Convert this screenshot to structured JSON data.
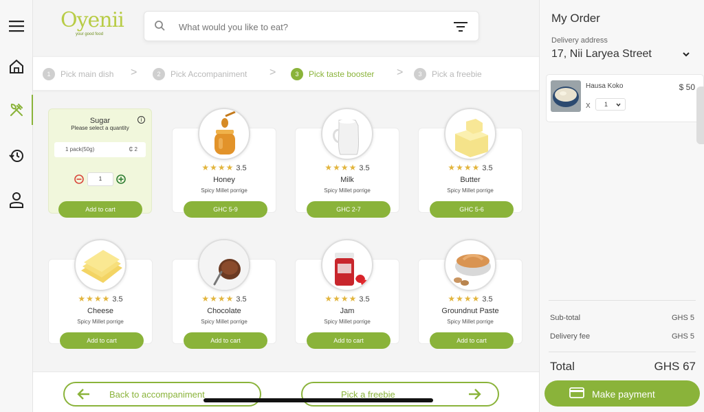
{
  "brand": {
    "logo_text": "Oyenii",
    "tagline": "your good food",
    "accent": "#8ab33a",
    "logo_color": "#b8cc46"
  },
  "nav": {
    "items": [
      "menu-icon",
      "home-icon",
      "cutlery-icon",
      "history-icon",
      "user-icon"
    ],
    "active": "cutlery-icon"
  },
  "search": {
    "placeholder": "What would you like to eat?",
    "value": ""
  },
  "steps": [
    {
      "num": "1",
      "label": "Pick main dish",
      "state": "done"
    },
    {
      "num": "2",
      "label": "Pick Accompaniment",
      "state": "done"
    },
    {
      "num": "3",
      "label": "Pick taste booster",
      "state": "active"
    },
    {
      "num": "3",
      "label": "Pick a freebie",
      "state": "todo"
    }
  ],
  "step_separator": ">",
  "selected_item": {
    "name": "Sugar",
    "subtitle": "Please select a quantity",
    "info": "i",
    "option_label": "1 pack(50g)",
    "option_price": "₵ 2",
    "quantity": "1",
    "button": "Add to cart"
  },
  "products": [
    {
      "name": "Honey",
      "desc": "Spicy Millet porrige",
      "rating": "3.5",
      "stars": "★★★★",
      "button": "GHC 5-9",
      "image": "honey-jar"
    },
    {
      "name": "Milk",
      "desc": "Spicy Millet porrige",
      "rating": "3.5",
      "stars": "★★★★",
      "button": "GHC 2-7",
      "image": "milk-jug"
    },
    {
      "name": "Butter",
      "desc": "Spicy Millet porrige",
      "rating": "3.5",
      "stars": "★★★★",
      "button": "GHC 5-6",
      "image": "butter-block"
    },
    {
      "name": "Cheese",
      "desc": "Spicy Millet porrige",
      "rating": "3.5",
      "stars": "★★★★",
      "button": "Add to cart",
      "image": "cheese-slices"
    },
    {
      "name": "Chocolate",
      "desc": "Spicy Millet porrige",
      "rating": "3.5",
      "stars": "★★★★",
      "button": "Add to cart",
      "image": "chocolate-cup"
    },
    {
      "name": "Jam",
      "desc": "Spicy Millet porrige",
      "rating": "3.5",
      "stars": "★★★★",
      "button": "Add to cart",
      "image": "jam-jar"
    },
    {
      "name": "Groundnut Paste",
      "desc": "Spicy Millet porrige",
      "rating": "3.5",
      "stars": "★★★★",
      "button": "Add to cart",
      "image": "groundnut-bowl"
    }
  ],
  "footer": {
    "back_label": "Back to accompaniment",
    "next_label": "Pick a freebie"
  },
  "order": {
    "title": "My Order",
    "delivery_label": "Delivery address",
    "delivery_address": "17, Nii Laryea Street",
    "items": [
      {
        "name": "Hausa Koko",
        "price": "$ 50",
        "qty_prefix": "X",
        "qty": "1",
        "image": "porridge-bowl"
      }
    ],
    "subtotal_label": "Sub-total",
    "subtotal_value": "GHS 5",
    "delivery_fee_label": "Delivery fee",
    "delivery_fee_value": "GHS 5",
    "total_label": "Total",
    "total_value": "GHS 67",
    "pay_label": "Make payment"
  }
}
